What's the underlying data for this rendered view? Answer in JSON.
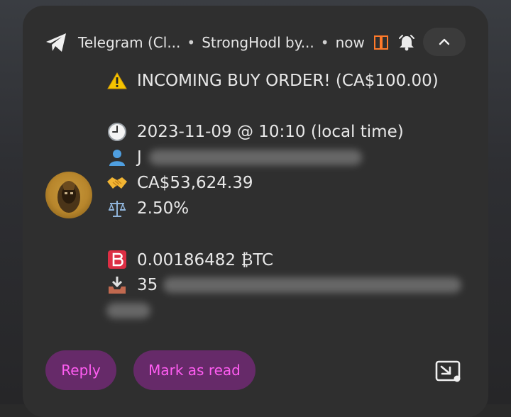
{
  "notification": {
    "app_name": "Telegram (Cl...",
    "separator": "•",
    "chat_name": "StrongHodl by...",
    "time": "now",
    "icons": {
      "app": "telegram-paper-plane-icon",
      "snooze": "snooze-icon",
      "bell": "alarm-bell-icon",
      "collapse": "chevron-up-icon",
      "expand": "picture-in-picture-icon"
    }
  },
  "message": {
    "headline_emoji": "warning-icon",
    "headline": "INCOMING BUY ORDER! (CA$100.00)",
    "datetime": "2023-11-09 @ 10:10 (local time)",
    "user_prefix": "J",
    "rate": "CA$53,624.39",
    "fee": "2.50%",
    "btc_amount": "0.00186482 ₿TC",
    "address_prefix": "35"
  },
  "actions": {
    "reply_label": "Reply",
    "mark_read_label": "Mark as read"
  },
  "colors": {
    "card_bg": "#2f2f2f",
    "action_bg": "#662a69",
    "action_text": "#ff5cf2",
    "text": "#e8e8e8",
    "snooze_accent": "#ff7a2a"
  }
}
